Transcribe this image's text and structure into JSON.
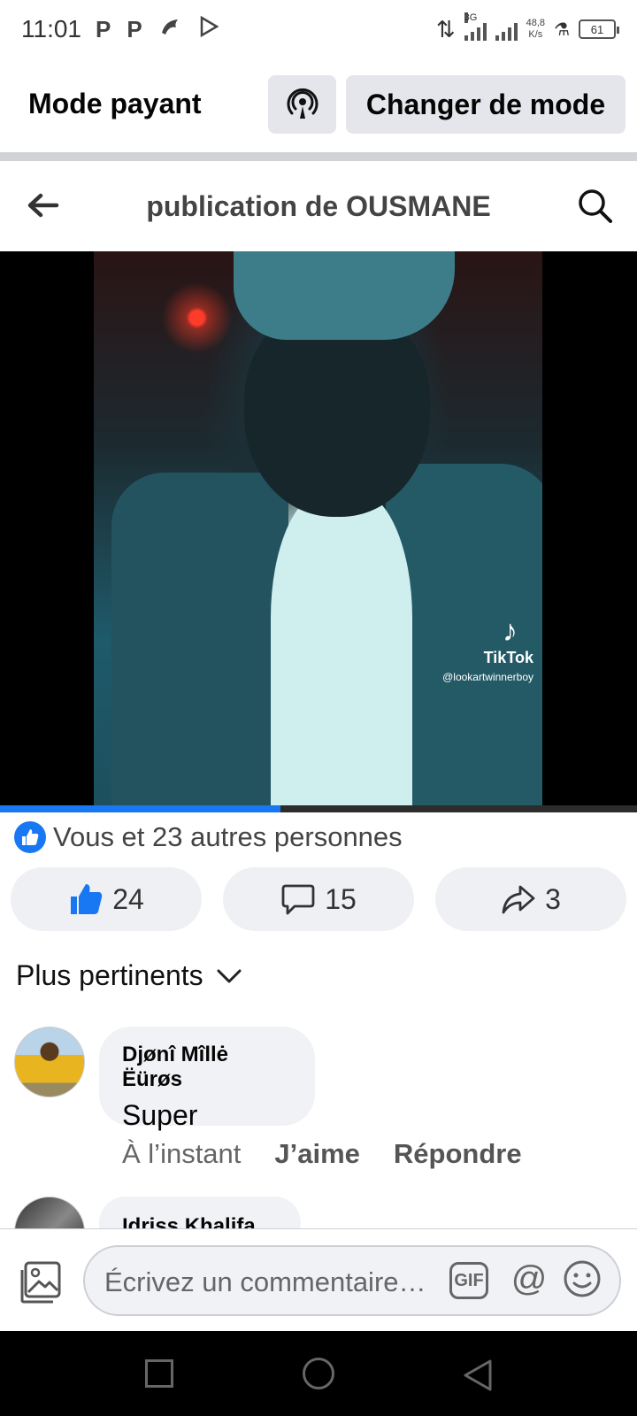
{
  "status_bar": {
    "time": "11:01",
    "app_icons": [
      "P",
      "P",
      "tiktok-like-icon",
      "play-store-icon"
    ],
    "network_type": "3G",
    "speed_value": "48,8",
    "speed_unit": "K/s",
    "battery": "61"
  },
  "mode_bar": {
    "title": "Mode payant",
    "change_mode_label": "Changer de mode"
  },
  "post_header": {
    "title": "publication de OUSMANE"
  },
  "video": {
    "watermark_label": "TikTok",
    "watermark_handle": "@lookartwinnerboy",
    "progress": 0.44
  },
  "reactions": {
    "summary": "Vous et 23 autres personnes"
  },
  "actions": {
    "like_count": "24",
    "comment_count": "15",
    "share_count": "3"
  },
  "sort": {
    "label": "Plus pertinents"
  },
  "comments": [
    {
      "author": "Djønî Mîllė Ëürøs",
      "text": "Super",
      "time": "À l’instant",
      "like_label": "J’aime",
      "reply_label": "Répondre"
    },
    {
      "author": "Idriss Khalifa"
    }
  ],
  "composer": {
    "placeholder": "Écrivez un commentaire…",
    "gif_label": "GIF",
    "mention_label": "@"
  },
  "colors": {
    "accent": "#1877f2",
    "button_bg": "#e4e6eb",
    "bubble_bg": "#f0f2f5"
  }
}
